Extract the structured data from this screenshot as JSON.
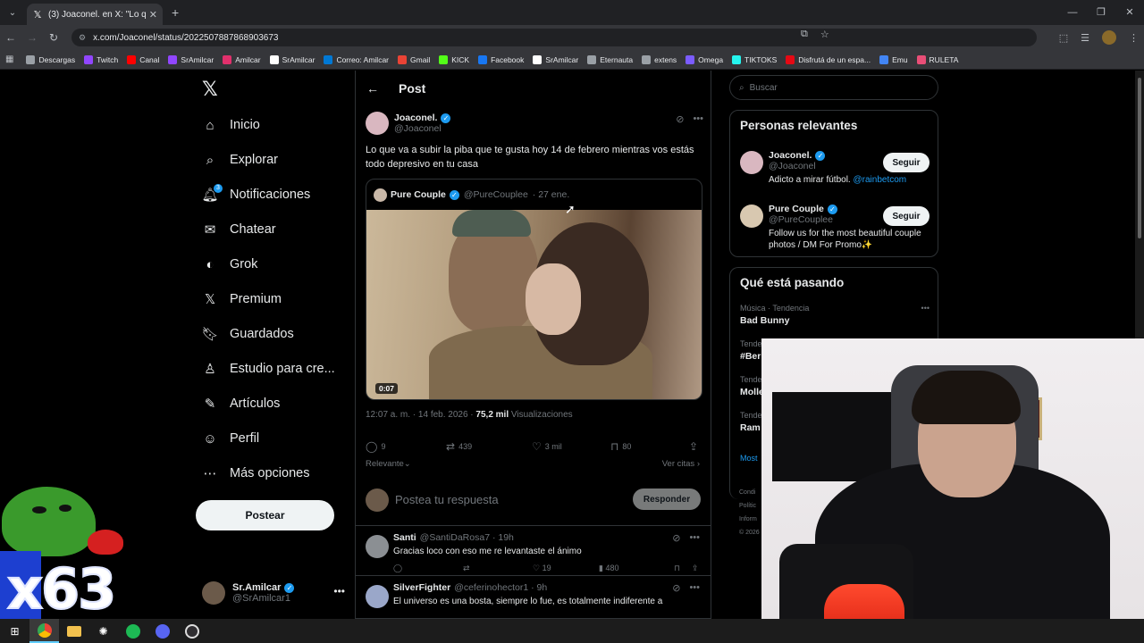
{
  "browser": {
    "tab_title": "(3) Joaconel. en X: \"Lo que va a",
    "url": "x.com/Joaconel/status/2022507887868903673",
    "bookmarks": [
      {
        "label": "Descargas",
        "color": "#9aa0a6"
      },
      {
        "label": "Twitch",
        "color": "#9146ff"
      },
      {
        "label": "Canal",
        "color": "#ff0000"
      },
      {
        "label": "SrAmilcar",
        "color": "#9146ff"
      },
      {
        "label": "Amilcar",
        "color": "#e1306c"
      },
      {
        "label": "SrAmilcar",
        "color": "#ffffff"
      },
      {
        "label": "Correo: Amilcar",
        "color": "#0078d4"
      },
      {
        "label": "Gmail",
        "color": "#ea4335"
      },
      {
        "label": "KICK",
        "color": "#53fc18"
      },
      {
        "label": "Facebook",
        "color": "#1877f2"
      },
      {
        "label": "SrAmilcar",
        "color": "#ffffff"
      },
      {
        "label": "Eternauta",
        "color": "#9aa0a6"
      },
      {
        "label": "extens",
        "color": "#9aa0a6"
      },
      {
        "label": "Omega",
        "color": "#7b5cff"
      },
      {
        "label": "TIKTOKS",
        "color": "#25f4ee"
      },
      {
        "label": "Disfrutá de un espa...",
        "color": "#e50914"
      },
      {
        "label": "Emu",
        "color": "#4285f4"
      },
      {
        "label": "RULETA",
        "color": "#e94e77"
      }
    ]
  },
  "nav": {
    "items": [
      {
        "label": "Inicio",
        "icon": "home-icon",
        "glyph": "⌂"
      },
      {
        "label": "Explorar",
        "icon": "search-icon",
        "glyph": "⌕"
      },
      {
        "label": "Notificaciones",
        "icon": "bell-icon",
        "glyph": "🔔︎",
        "badge": "3"
      },
      {
        "label": "Chatear",
        "icon": "mail-icon",
        "glyph": "✉"
      },
      {
        "label": "Grok",
        "icon": "grok-icon",
        "glyph": "◐"
      },
      {
        "label": "Premium",
        "icon": "x-icon",
        "glyph": "𝕏"
      },
      {
        "label": "Guardados",
        "icon": "bookmark-icon",
        "glyph": "🔖︎"
      },
      {
        "label": "Estudio para cre...",
        "icon": "studio-icon",
        "glyph": "♙"
      },
      {
        "label": "Artículos",
        "icon": "article-icon",
        "glyph": "✎"
      },
      {
        "label": "Perfil",
        "icon": "person-icon",
        "glyph": "☺"
      },
      {
        "label": "Más opciones",
        "icon": "more-icon",
        "glyph": "⋯"
      }
    ],
    "post_button": "Postear",
    "account": {
      "name": "Sr.Amilcar",
      "handle": "@SrAmilcar1"
    }
  },
  "post": {
    "header": "Post",
    "author_name": "Joaconel.",
    "author_handle": "@Joaconel",
    "text": "Lo que va a subir la piba que te gusta hoy 14 de febrero mientras vos estás todo depresivo en tu casa",
    "quote": {
      "name": "Pure Couple",
      "handle": "@PureCouplee",
      "date": "· 27 ene.",
      "video_time": "0:07"
    },
    "meta_time": "12:07 a. m. · 14 feb. 2026 ·",
    "views": "75,2 mil",
    "views_label": "Visualizaciones",
    "replies": "9",
    "reposts": "439",
    "likes": "3 mil",
    "bookmarks": "80",
    "sort_label": "Relevante",
    "quotes_link": "Ver citas",
    "reply_placeholder": "Postea tu respuesta",
    "reply_button": "Responder"
  },
  "replies": [
    {
      "name": "Santi",
      "handle": "@SantiDaRosa7 · 19h",
      "text": "Gracias loco con eso me re levantaste el ánimo",
      "likes": "19",
      "views": "480"
    },
    {
      "name": "SilverFighter",
      "handle": "@ceferinohector1 · 9h",
      "text": "El universo es una bosta, siempre lo fue, es totalmente indiferente a",
      "likes": "",
      "views": ""
    }
  ],
  "sidebar": {
    "search_placeholder": "Buscar",
    "relevant_title": "Personas relevantes",
    "people": [
      {
        "name": "Joaconel.",
        "handle": "@Joaconel",
        "bio": "Adicto a mirar fútbol.",
        "bio_link": "@rainbetcom",
        "button": "Seguir"
      },
      {
        "name": "Pure Couple",
        "handle": "@PureCouplee",
        "bio": "Follow us for the most beautiful couple photos / DM For Promo✨",
        "bio_link": "",
        "button": "Seguir"
      }
    ],
    "trending_title": "Qué está pasando",
    "trends": [
      {
        "category": "Música · Tendencia",
        "name": "Bad Bunny"
      },
      {
        "category": "Tende",
        "name": "#Ber"
      },
      {
        "category": "Tende",
        "name": "Molle"
      },
      {
        "category": "Tende",
        "name": "Ram"
      }
    ],
    "show_more": "Most",
    "footer": [
      "Condi",
      "Polític",
      "Inform",
      "© 2026"
    ]
  },
  "overlay": {
    "emote_count": "x63"
  }
}
